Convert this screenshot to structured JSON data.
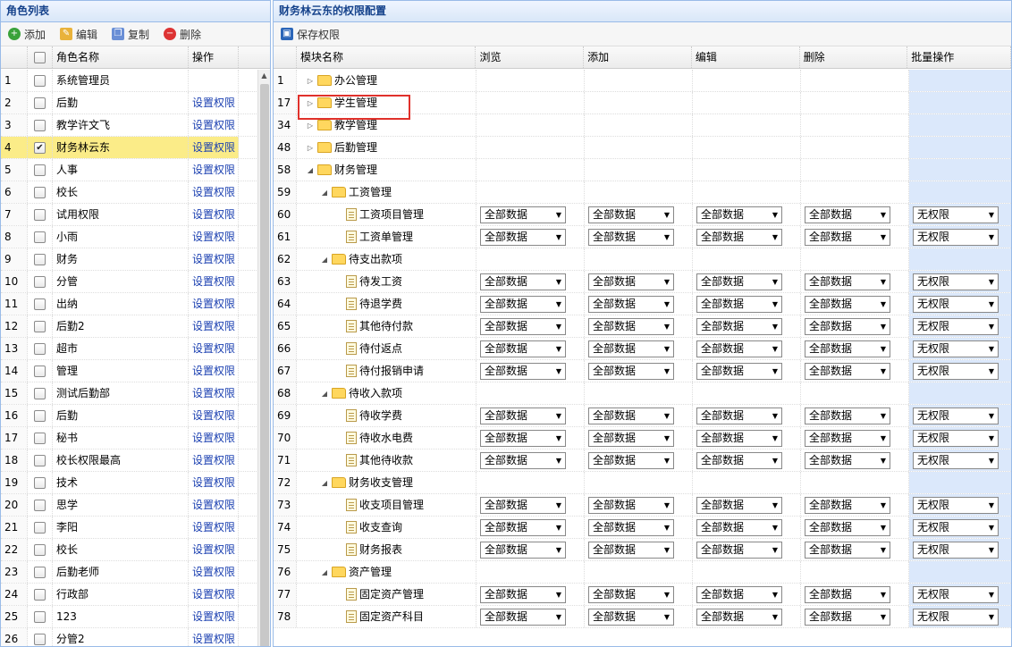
{
  "left": {
    "title": "角色列表",
    "toolbar": {
      "add": "添加",
      "edit": "编辑",
      "copy": "复制",
      "delete": "删除"
    },
    "headers": {
      "name": "角色名称",
      "op": "操作"
    },
    "rows": [
      {
        "num": "1",
        "name": "系统管理员",
        "op": "",
        "checked": false
      },
      {
        "num": "2",
        "name": "后勤",
        "op": "设置权限",
        "checked": false
      },
      {
        "num": "3",
        "name": "教学许文飞",
        "op": "设置权限",
        "checked": false
      },
      {
        "num": "4",
        "name": "财务林云东",
        "op": "设置权限",
        "checked": true
      },
      {
        "num": "5",
        "name": "人事",
        "op": "设置权限",
        "checked": false
      },
      {
        "num": "6",
        "name": "校长",
        "op": "设置权限",
        "checked": false
      },
      {
        "num": "7",
        "name": "试用权限",
        "op": "设置权限",
        "checked": false
      },
      {
        "num": "8",
        "name": "小雨",
        "op": "设置权限",
        "checked": false
      },
      {
        "num": "9",
        "name": "财务",
        "op": "设置权限",
        "checked": false
      },
      {
        "num": "10",
        "name": "分管",
        "op": "设置权限",
        "checked": false
      },
      {
        "num": "11",
        "name": "出纳",
        "op": "设置权限",
        "checked": false
      },
      {
        "num": "12",
        "name": "后勤2",
        "op": "设置权限",
        "checked": false
      },
      {
        "num": "13",
        "name": "超市",
        "op": "设置权限",
        "checked": false
      },
      {
        "num": "14",
        "name": "管理",
        "op": "设置权限",
        "checked": false
      },
      {
        "num": "15",
        "name": "测试后勤部",
        "op": "设置权限",
        "checked": false
      },
      {
        "num": "16",
        "name": "后勤",
        "op": "设置权限",
        "checked": false
      },
      {
        "num": "17",
        "name": "秘书",
        "op": "设置权限",
        "checked": false
      },
      {
        "num": "18",
        "name": "校长权限最高",
        "op": "设置权限",
        "checked": false
      },
      {
        "num": "19",
        "name": "技术",
        "op": "设置权限",
        "checked": false
      },
      {
        "num": "20",
        "name": "思学",
        "op": "设置权限",
        "checked": false
      },
      {
        "num": "21",
        "name": "李阳",
        "op": "设置权限",
        "checked": false
      },
      {
        "num": "22",
        "name": "校长",
        "op": "设置权限",
        "checked": false
      },
      {
        "num": "23",
        "name": "后勤老师",
        "op": "设置权限",
        "checked": false
      },
      {
        "num": "24",
        "name": "行政部",
        "op": "设置权限",
        "checked": false
      },
      {
        "num": "25",
        "name": "123",
        "op": "设置权限",
        "checked": false
      },
      {
        "num": "26",
        "name": "分管2",
        "op": "设置权限",
        "checked": false
      }
    ]
  },
  "right": {
    "title": "财务林云东的权限配置",
    "toolbar": {
      "save": "保存权限"
    },
    "headers": {
      "module": "模块名称",
      "browse": "浏览",
      "add": "添加",
      "edit": "编辑",
      "delete": "删除",
      "batch": "批量操作"
    },
    "rows": [
      {
        "num": "1",
        "name": "办公管理",
        "level": 0,
        "type": "folder",
        "toggle": "closed"
      },
      {
        "num": "17",
        "name": "学生管理",
        "level": 0,
        "type": "folder",
        "toggle": "closed"
      },
      {
        "num": "34",
        "name": "教学管理",
        "level": 0,
        "type": "folder",
        "toggle": "closed"
      },
      {
        "num": "48",
        "name": "后勤管理",
        "level": 0,
        "type": "folder",
        "toggle": "closed"
      },
      {
        "num": "58",
        "name": "财务管理",
        "level": 0,
        "type": "folder",
        "toggle": "open"
      },
      {
        "num": "59",
        "name": "工资管理",
        "level": 1,
        "type": "folder",
        "toggle": "open"
      },
      {
        "num": "60",
        "name": "工资项目管理",
        "level": 2,
        "type": "file",
        "sel": "全部数据",
        "batch": "无权限"
      },
      {
        "num": "61",
        "name": "工资单管理",
        "level": 2,
        "type": "file",
        "sel": "全部数据",
        "batch": "无权限"
      },
      {
        "num": "62",
        "name": "待支出款项",
        "level": 1,
        "type": "folder",
        "toggle": "open"
      },
      {
        "num": "63",
        "name": "待发工资",
        "level": 2,
        "type": "file",
        "sel": "全部数据",
        "batch": "无权限"
      },
      {
        "num": "64",
        "name": "待退学费",
        "level": 2,
        "type": "file",
        "sel": "全部数据",
        "batch": "无权限"
      },
      {
        "num": "65",
        "name": "其他待付款",
        "level": 2,
        "type": "file",
        "sel": "全部数据",
        "batch": "无权限"
      },
      {
        "num": "66",
        "name": "待付返点",
        "level": 2,
        "type": "file",
        "sel": "全部数据",
        "batch": "无权限"
      },
      {
        "num": "67",
        "name": "待付报销申请",
        "level": 2,
        "type": "file",
        "sel": "全部数据",
        "batch": "无权限"
      },
      {
        "num": "68",
        "name": "待收入款项",
        "level": 1,
        "type": "folder",
        "toggle": "open"
      },
      {
        "num": "69",
        "name": "待收学费",
        "level": 2,
        "type": "file",
        "sel": "全部数据",
        "batch": "无权限"
      },
      {
        "num": "70",
        "name": "待收水电费",
        "level": 2,
        "type": "file",
        "sel": "全部数据",
        "batch": "无权限"
      },
      {
        "num": "71",
        "name": "其他待收款",
        "level": 2,
        "type": "file",
        "sel": "全部数据",
        "batch": "无权限"
      },
      {
        "num": "72",
        "name": "财务收支管理",
        "level": 1,
        "type": "folder",
        "toggle": "open"
      },
      {
        "num": "73",
        "name": "收支项目管理",
        "level": 2,
        "type": "file",
        "sel": "全部数据",
        "batch": "无权限"
      },
      {
        "num": "74",
        "name": "收支查询",
        "level": 2,
        "type": "file",
        "sel": "全部数据",
        "batch": "无权限"
      },
      {
        "num": "75",
        "name": "财务报表",
        "level": 2,
        "type": "file",
        "sel": "全部数据",
        "batch": "无权限"
      },
      {
        "num": "76",
        "name": "资产管理",
        "level": 1,
        "type": "folder",
        "toggle": "open"
      },
      {
        "num": "77",
        "name": "固定资产管理",
        "level": 2,
        "type": "file",
        "sel": "全部数据",
        "batch": "无权限"
      },
      {
        "num": "78",
        "name": "固定资产科目",
        "level": 2,
        "type": "file",
        "sel": "全部数据",
        "batch": "无权限"
      }
    ]
  }
}
